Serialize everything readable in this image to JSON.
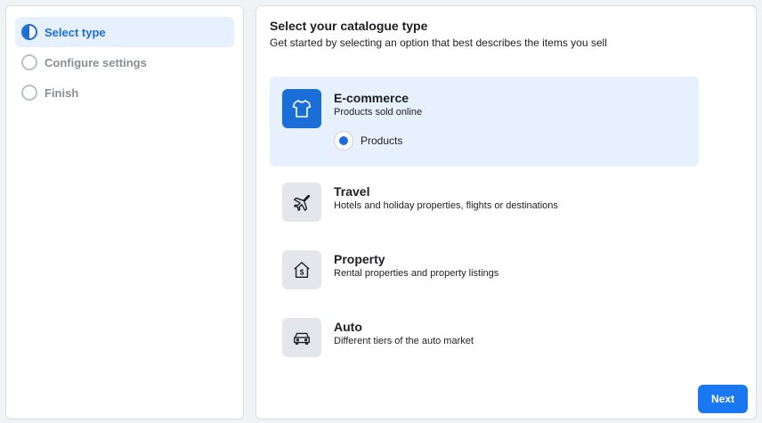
{
  "steps": [
    {
      "label": "Select type",
      "active": true
    },
    {
      "label": "Configure settings",
      "active": false
    },
    {
      "label": "Finish",
      "active": false
    }
  ],
  "main": {
    "title": "Select your catalogue type",
    "subtitle": "Get started by selecting an option that best describes the items you sell"
  },
  "options": [
    {
      "title": "E-commerce",
      "desc": "Products sold online",
      "icon": "tshirt-icon",
      "selected": true,
      "radio_label": "Products"
    },
    {
      "title": "Travel",
      "desc": "Hotels and holiday properties, flights or destinations",
      "icon": "airplane-icon",
      "selected": false
    },
    {
      "title": "Property",
      "desc": "Rental properties and property listings",
      "icon": "house-dollar-icon",
      "selected": false
    },
    {
      "title": "Auto",
      "desc": "Different tiers of the auto market",
      "icon": "car-icon",
      "selected": false
    }
  ],
  "buttons": {
    "next": "Next"
  },
  "colors": {
    "accent": "#1a6ed8",
    "selected_bg": "#e7f0fd",
    "button": "#1a77f2"
  }
}
